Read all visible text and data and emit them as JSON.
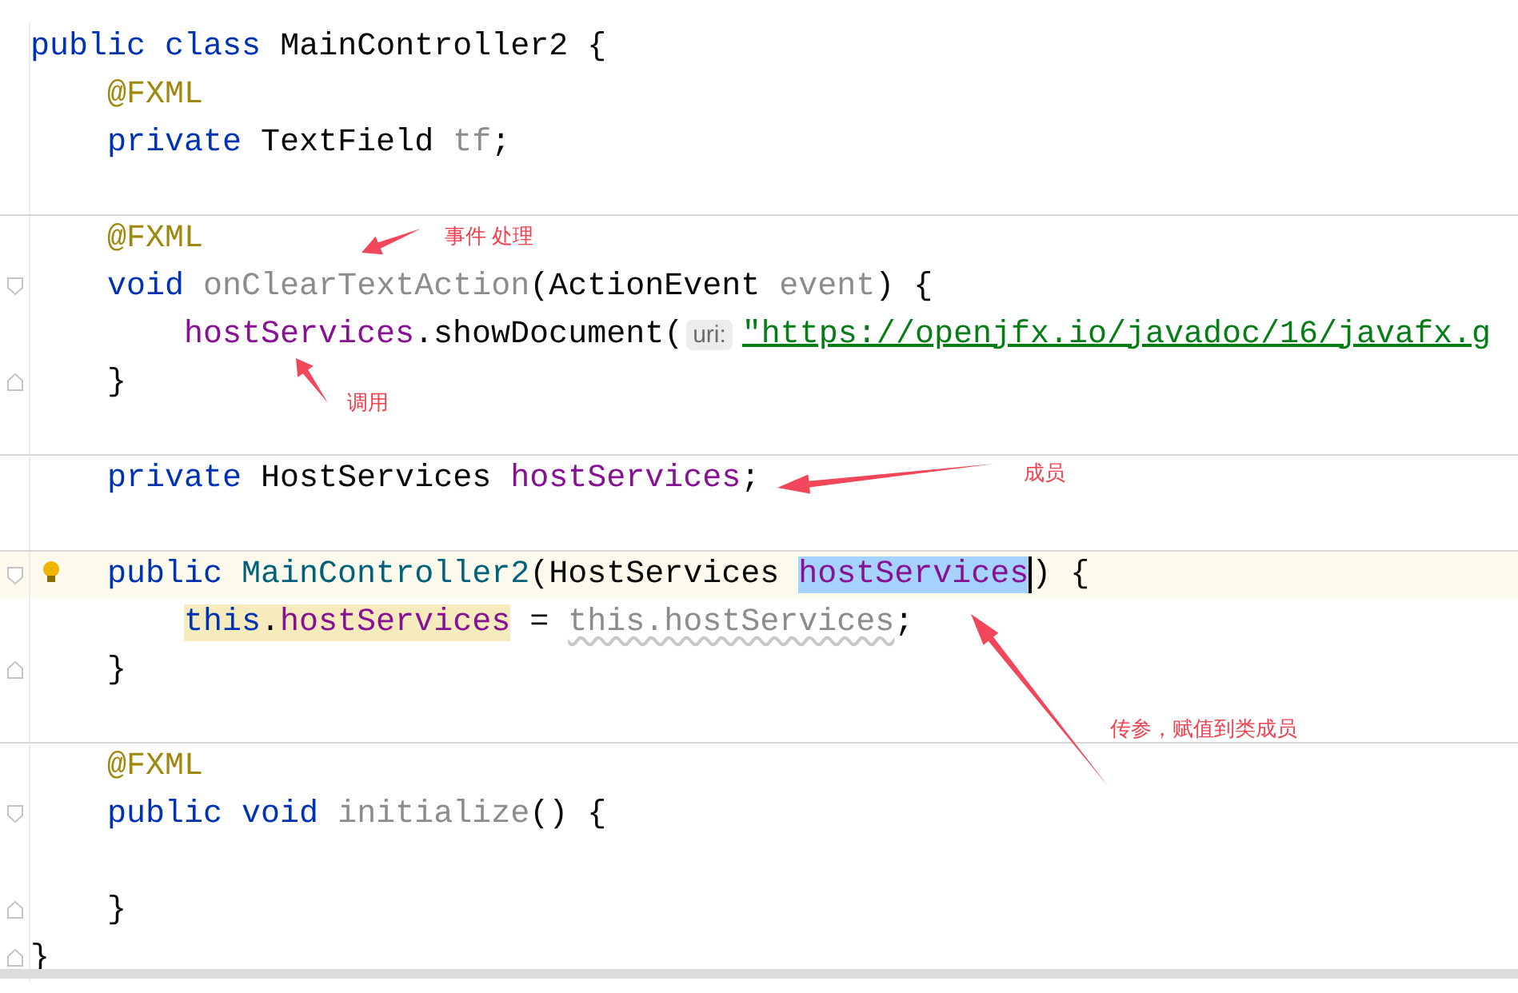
{
  "editor": {
    "lines": [
      {
        "kind": "code",
        "tokens": [
          {
            "kind": "keyword",
            "text": "public "
          },
          {
            "kind": "keyword",
            "text": "class "
          },
          {
            "kind": "plain",
            "text": "MainController2 "
          },
          {
            "kind": "plain",
            "text": "{"
          }
        ]
      },
      {
        "kind": "code",
        "tokens": [
          {
            "kind": "annotation",
            "text": "    @FXML"
          }
        ]
      },
      {
        "kind": "code",
        "tokens": [
          {
            "kind": "keyword",
            "text": "    private "
          },
          {
            "kind": "plain",
            "text": "TextField "
          },
          {
            "kind": "unused",
            "text": "tf"
          },
          {
            "kind": "plain",
            "text": ";"
          }
        ]
      },
      {
        "kind": "blank"
      },
      {
        "kind": "code",
        "separator": true,
        "tokens": [
          {
            "kind": "annotation",
            "text": "    @FXML"
          }
        ]
      },
      {
        "kind": "code",
        "fold_start": true,
        "tokens": [
          {
            "kind": "keyword",
            "text": "    void "
          },
          {
            "kind": "unused",
            "text": "onClearTextAction"
          },
          {
            "kind": "plain",
            "text": "("
          },
          {
            "kind": "plain",
            "text": "ActionEvent "
          },
          {
            "kind": "unused",
            "text": "event"
          },
          {
            "kind": "plain",
            "text": ") {"
          }
        ]
      },
      {
        "kind": "code",
        "tokens": [
          {
            "kind": "field",
            "text": "        hostServices"
          },
          {
            "kind": "plain",
            "text": ".showDocument("
          },
          {
            "kind": "hint",
            "text": "uri:"
          },
          {
            "kind": "string",
            "text": "\"https://openjfx.io/javadoc/16/javafx.g"
          }
        ]
      },
      {
        "kind": "code",
        "fold_end": true,
        "tokens": [
          {
            "kind": "plain",
            "text": "    }"
          }
        ]
      },
      {
        "kind": "blank"
      },
      {
        "kind": "code",
        "separator": true,
        "tokens": [
          {
            "kind": "keyword",
            "text": "    private "
          },
          {
            "kind": "plain",
            "text": "HostServices "
          },
          {
            "kind": "field",
            "text": "hostServices"
          },
          {
            "kind": "plain",
            "text": ";"
          }
        ]
      },
      {
        "kind": "blank"
      },
      {
        "kind": "code",
        "separator": true,
        "current": true,
        "bulb": true,
        "fold_start": true,
        "tokens": [
          {
            "kind": "keyword",
            "text": "    public "
          },
          {
            "kind": "declaration",
            "text": "MainController2"
          },
          {
            "kind": "plain",
            "text": "(HostServices "
          },
          {
            "kind": "field",
            "text": "hostServices",
            "selected": true
          },
          {
            "kind": "plain",
            "text": ") {"
          }
        ]
      },
      {
        "kind": "code",
        "tokens": [
          {
            "kind": "keyword",
            "text": "        this",
            "write_usage": true
          },
          {
            "kind": "plain",
            "text": ".",
            "write_usage": true
          },
          {
            "kind": "field",
            "text": "hostServices",
            "write_usage": true
          },
          {
            "kind": "plain",
            "text": " = "
          },
          {
            "kind": "unused",
            "text": "this.hostServices",
            "warning": true
          },
          {
            "kind": "plain",
            "text": ";"
          }
        ]
      },
      {
        "kind": "code",
        "fold_end": true,
        "tokens": [
          {
            "kind": "plain",
            "text": "    }"
          }
        ]
      },
      {
        "kind": "blank"
      },
      {
        "kind": "code",
        "separator": true,
        "tokens": [
          {
            "kind": "annotation",
            "text": "    @FXML"
          }
        ]
      },
      {
        "kind": "code",
        "fold_start": true,
        "tokens": [
          {
            "kind": "keyword",
            "text": "    public "
          },
          {
            "kind": "keyword",
            "text": "void "
          },
          {
            "kind": "unused",
            "text": "initialize"
          },
          {
            "kind": "plain",
            "text": "() {"
          }
        ]
      },
      {
        "kind": "blank"
      },
      {
        "kind": "code",
        "fold_end": true,
        "tokens": [
          {
            "kind": "plain",
            "text": "    }"
          }
        ]
      },
      {
        "kind": "code",
        "fold_end": true,
        "tokens": [
          {
            "kind": "plain",
            "text": "}"
          }
        ]
      }
    ]
  },
  "annotations": [
    {
      "label": "事件 处理"
    },
    {
      "label": "调用"
    },
    {
      "label": "成员"
    },
    {
      "label": "传参，赋值到类成员"
    }
  ]
}
